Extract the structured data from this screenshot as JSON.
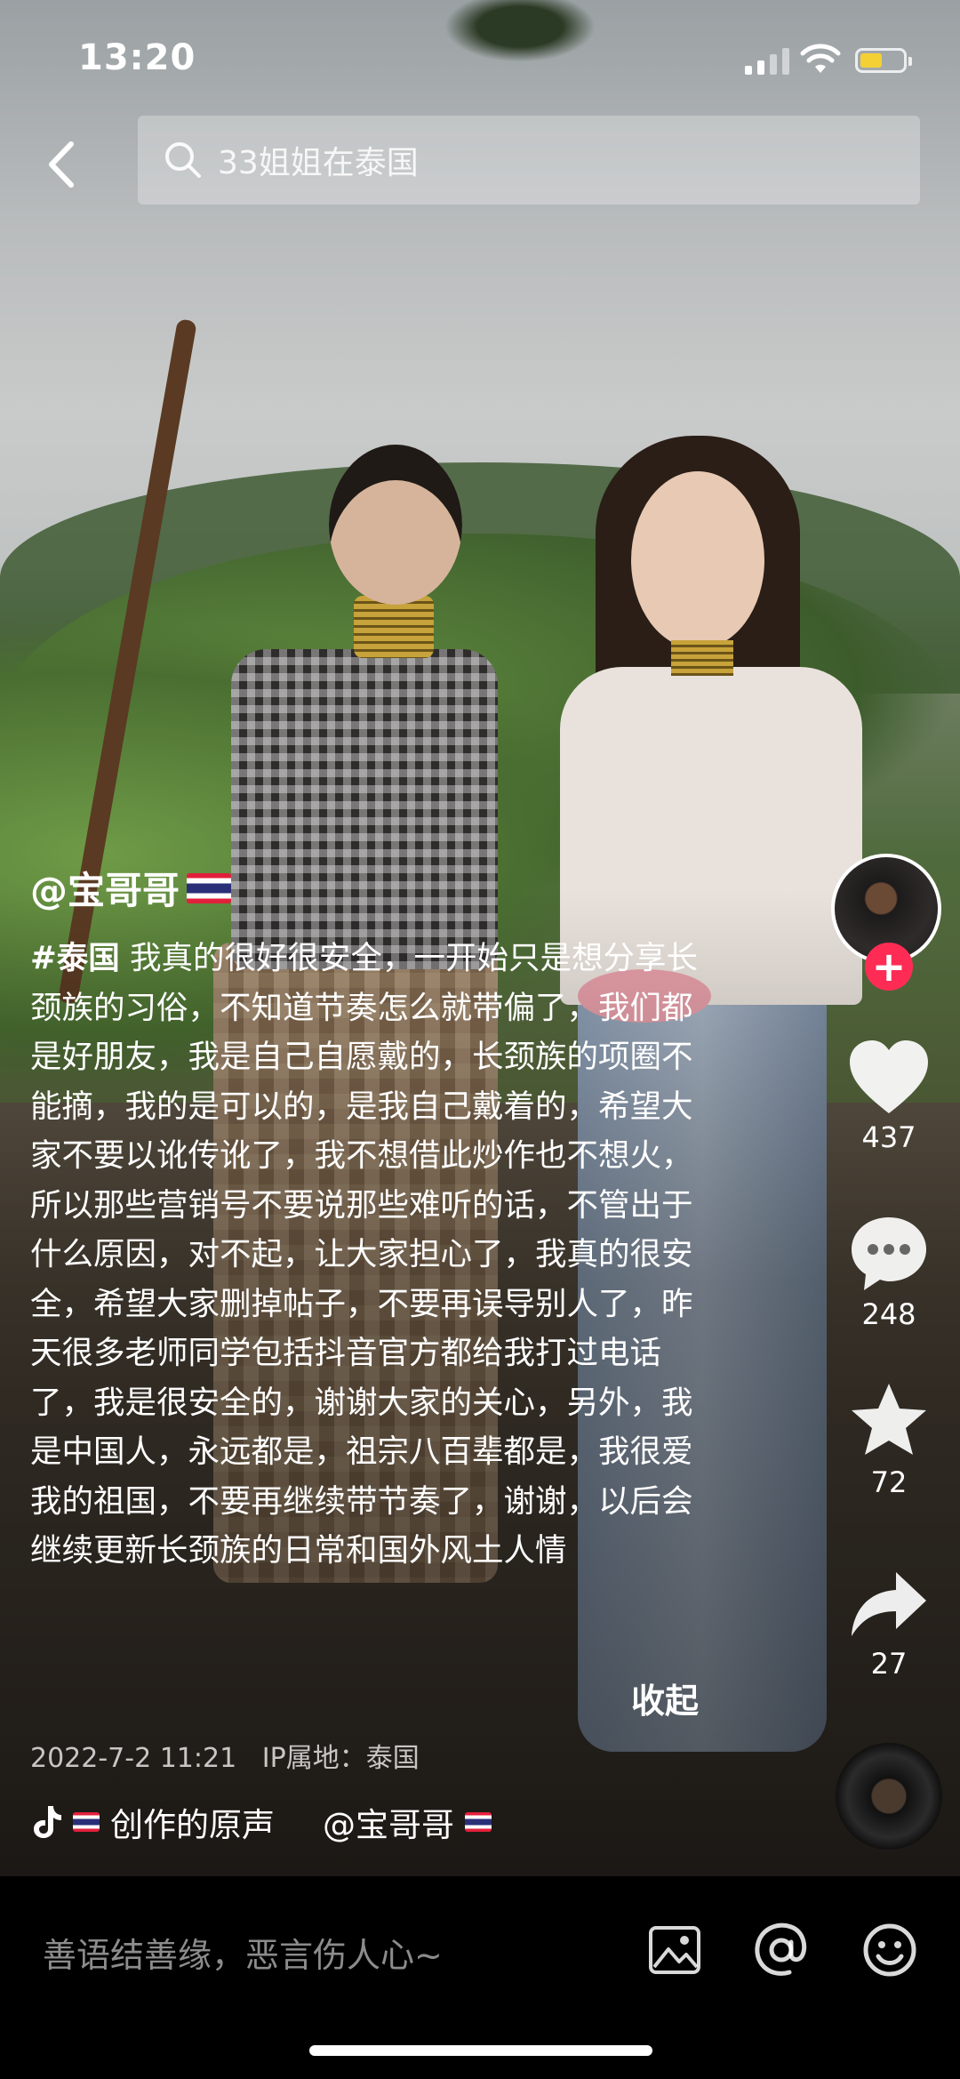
{
  "status_bar": {
    "time": "13:20"
  },
  "search": {
    "query": "33姐姐在泰国"
  },
  "video": {
    "author": "@宝哥哥",
    "hashtag": "#泰国",
    "description": " 我真的很好很安全，一开始只是想分享长颈族的习俗，不知道节奏怎么就带偏了，我们都是好朋友，我是自己自愿戴的，长颈族的项圈不能摘，我的是可以的，是我自己戴着的，希望大家不要以讹传讹了，我不想借此炒作也不想火，所以那些营销号不要说那些难听的话，不管出于什么原因，对不起，让大家担心了，我真的很安全，希望大家删掉帖子，不要再误导别人了，昨天很多老师同学包括抖音官方都给我打过电话了，我是很安全的，谢谢大家的关心，另外，我是中国人，永远都是，祖宗八百辈都是，我很爱我的祖国，不要再继续带节奏了，谢谢，以后会继续更新长颈族的日常和国外风土人情",
    "collapse_label": "收起",
    "date": "2022-7-2 11:21",
    "ip_location": "IP属地：泰国",
    "music_title": "创作的原声",
    "music_author": "@宝哥哥"
  },
  "actions": {
    "likes": "437",
    "comments": "248",
    "favorites": "72",
    "shares": "27"
  },
  "comment_bar": {
    "placeholder": "善语结善缘，恶言伤人心~"
  },
  "icons": {
    "back": "back-arrow-icon",
    "search": "search-icon",
    "follow": "plus-icon",
    "like": "heart-icon",
    "comment": "comment-bubble-icon",
    "favorite": "star-icon",
    "share": "share-arrow-icon",
    "music": "tiktok-note-icon",
    "image": "image-icon",
    "mention": "at-sign-icon",
    "emoji": "emoji-icon"
  },
  "colors": {
    "follow_accent": "#fe2c55",
    "battery_level": "#f4d035"
  }
}
